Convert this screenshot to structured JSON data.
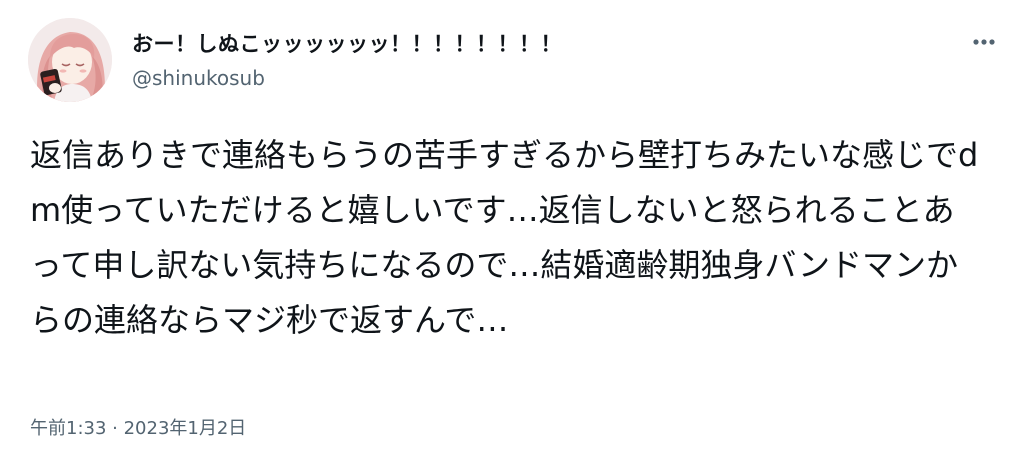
{
  "tweet": {
    "display_name": "おー！しぬこッッッッッッ！！！！！！！！",
    "handle": "@shinukosub",
    "text": "返信ありきで連絡もらうの苦手すぎるから壁打ちみたいな感じでdm使っていただけると嬉しいです…返信しないと怒られることあって申し訳ない気持ちになるので…結婚適齢期独身バンドマンからの連絡ならマジ秒で返すんで…",
    "timestamp": "午前1:33 · 2023年1月2日"
  },
  "icons": {
    "more": "more-horizontal-icon",
    "avatar": "avatar-illustration"
  },
  "colors": {
    "text_primary": "#0f1419",
    "text_secondary": "#536471",
    "background": "#ffffff"
  }
}
